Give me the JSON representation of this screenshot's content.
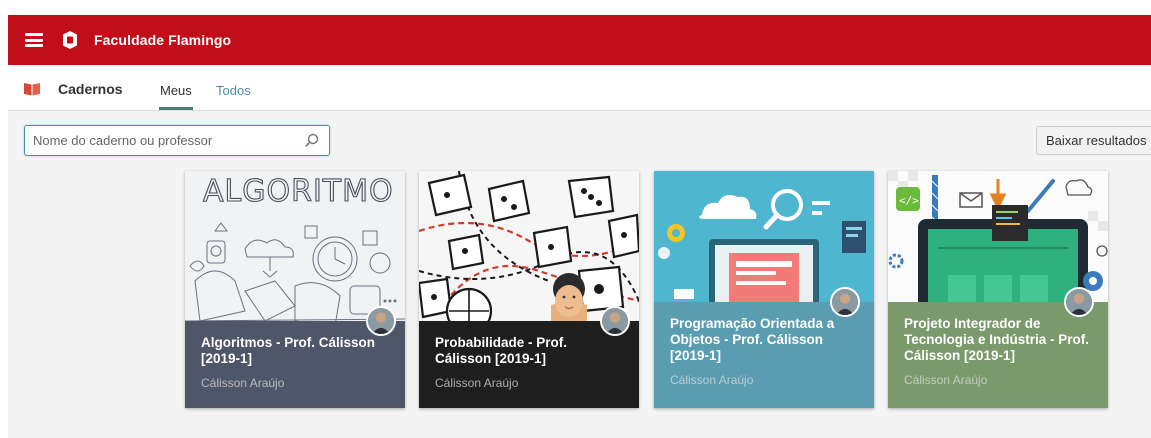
{
  "header": {
    "title": "Faculdade Flamingo",
    "bg_color": "#c20e1a"
  },
  "subnav": {
    "title": "Cadernos",
    "tabs": [
      {
        "label": "Meus",
        "active": true
      },
      {
        "label": "Todos",
        "active": false
      }
    ]
  },
  "search": {
    "placeholder": "Nome do caderno ou professor",
    "value": ""
  },
  "download_button": {
    "label": "Baixar resultados"
  },
  "cards": [
    {
      "title": "Algoritmos - Prof. Cálisson [2019-1]",
      "author": "Cálisson Araújo",
      "image_text": "ALGORITMO",
      "panel_color": "#4e5669"
    },
    {
      "title": "Probabilidade - Prof. Cálisson [2019-1]",
      "author": "Cálisson Araújo",
      "panel_color": "#1e1e1e"
    },
    {
      "title": "Programação Orientada a Objetos - Prof. Cálisson [2019-1]",
      "author": "Cálisson Araújo",
      "panel_color": "#5a9db0"
    },
    {
      "title": "Projeto Integrador de Tecnologia e Indústria - Prof. Cálisson [2019-1]",
      "author": "Cálisson Araújo",
      "panel_color": "#7a9a6c"
    }
  ],
  "icons": [
    "hamburger-menu-icon",
    "flamingo-logo-icon",
    "notebook-icon",
    "search-icon",
    "avatar"
  ]
}
